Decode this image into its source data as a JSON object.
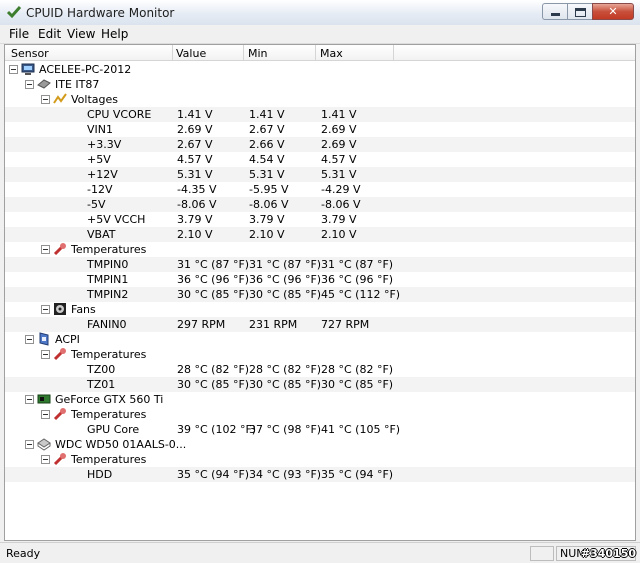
{
  "window": {
    "title": "CPUID Hardware Monitor"
  },
  "menu": [
    "File",
    "Edit",
    "View",
    "Help"
  ],
  "columns": [
    "Sensor",
    "Value",
    "Min",
    "Max"
  ],
  "tree": [
    {
      "depth": 0,
      "kind": "computer",
      "label": "ACELEE-PC-2012",
      "name": "tree-node-computer"
    },
    {
      "depth": 1,
      "kind": "chip",
      "label": "ITE IT87",
      "name": "tree-node-ite-it87"
    },
    {
      "depth": 2,
      "kind": "voltage",
      "label": "Voltages",
      "name": "tree-group-voltages"
    },
    {
      "depth": 3,
      "kind": "leaf",
      "label": "CPU VCORE",
      "value": "1.41 V",
      "min": "1.41 V",
      "max": "1.41 V"
    },
    {
      "depth": 3,
      "kind": "leaf",
      "label": "VIN1",
      "value": "2.69 V",
      "min": "2.67 V",
      "max": "2.69 V"
    },
    {
      "depth": 3,
      "kind": "leaf",
      "label": "+3.3V",
      "value": "2.67 V",
      "min": "2.66 V",
      "max": "2.69 V"
    },
    {
      "depth": 3,
      "kind": "leaf",
      "label": "+5V",
      "value": "4.57 V",
      "min": "4.54 V",
      "max": "4.57 V"
    },
    {
      "depth": 3,
      "kind": "leaf",
      "label": "+12V",
      "value": "5.31 V",
      "min": "5.31 V",
      "max": "5.31 V"
    },
    {
      "depth": 3,
      "kind": "leaf",
      "label": "-12V",
      "value": "-4.35 V",
      "min": "-5.95 V",
      "max": "-4.29 V"
    },
    {
      "depth": 3,
      "kind": "leaf",
      "label": "-5V",
      "value": "-8.06 V",
      "min": "-8.06 V",
      "max": "-8.06 V"
    },
    {
      "depth": 3,
      "kind": "leaf",
      "label": "+5V VCCH",
      "value": "3.79 V",
      "min": "3.79 V",
      "max": "3.79 V"
    },
    {
      "depth": 3,
      "kind": "leaf",
      "label": "VBAT",
      "value": "2.10 V",
      "min": "2.10 V",
      "max": "2.10 V"
    },
    {
      "depth": 2,
      "kind": "temp",
      "label": "Temperatures",
      "name": "tree-group-temperatures"
    },
    {
      "depth": 3,
      "kind": "leaf",
      "label": "TMPIN0",
      "value": "31 °C  (87 °F)",
      "min": "31 °C  (87 °F)",
      "max": "31 °C  (87 °F)"
    },
    {
      "depth": 3,
      "kind": "leaf",
      "label": "TMPIN1",
      "value": "36 °C  (96 °F)",
      "min": "36 °C  (96 °F)",
      "max": "36 °C  (96 °F)"
    },
    {
      "depth": 3,
      "kind": "leaf",
      "label": "TMPIN2",
      "value": "30 °C  (85 °F)",
      "min": "30 °C  (85 °F)",
      "max": "45 °C  (112 °F)"
    },
    {
      "depth": 2,
      "kind": "fan",
      "label": "Fans",
      "name": "tree-group-fans"
    },
    {
      "depth": 3,
      "kind": "leaf",
      "label": "FANIN0",
      "value": "297 RPM",
      "min": "231 RPM",
      "max": "727 RPM"
    },
    {
      "depth": 1,
      "kind": "acpi",
      "label": "ACPI",
      "name": "tree-node-acpi"
    },
    {
      "depth": 2,
      "kind": "temp",
      "label": "Temperatures",
      "name": "tree-group-temperatures"
    },
    {
      "depth": 3,
      "kind": "leaf",
      "label": "TZ00",
      "value": "28 °C  (82 °F)",
      "min": "28 °C  (82 °F)",
      "max": "28 °C  (82 °F)"
    },
    {
      "depth": 3,
      "kind": "leaf",
      "label": "TZ01",
      "value": "30 °C  (85 °F)",
      "min": "30 °C  (85 °F)",
      "max": "30 °C  (85 °F)"
    },
    {
      "depth": 1,
      "kind": "gpu",
      "label": "GeForce GTX 560 Ti",
      "name": "tree-node-gpu"
    },
    {
      "depth": 2,
      "kind": "temp",
      "label": "Temperatures",
      "name": "tree-group-temperatures"
    },
    {
      "depth": 3,
      "kind": "leaf",
      "label": "GPU Core",
      "value": "39 °C  (102 °F)",
      "min": "37 °C  (98 °F)",
      "max": "41 °C  (105 °F)"
    },
    {
      "depth": 1,
      "kind": "disk",
      "label": "WDC WD50 01AALS-0...",
      "name": "tree-node-disk"
    },
    {
      "depth": 2,
      "kind": "temp",
      "label": "Temperatures",
      "name": "tree-group-temperatures"
    },
    {
      "depth": 3,
      "kind": "leaf",
      "label": "HDD",
      "value": "35 °C  (94 °F)",
      "min": "34 °C  (93 °F)",
      "max": "35 °C  (94 °F)"
    }
  ],
  "status": {
    "text": "Ready",
    "num": "NUM",
    "watermark": "#340150"
  },
  "colors": {
    "title_bg": "#dbe3ee",
    "close_btn": "#c23a24",
    "alt_row": "#f3f3f3"
  }
}
